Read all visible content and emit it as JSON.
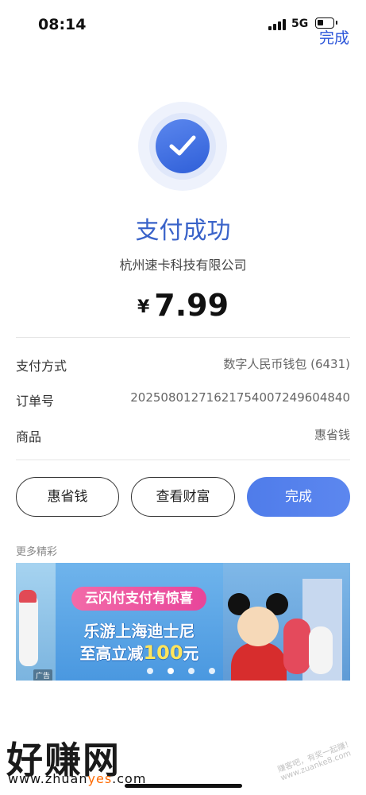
{
  "status_bar": {
    "time": "08:14",
    "network": "5G"
  },
  "header": {
    "done_link": "完成"
  },
  "result": {
    "title": "支付成功",
    "merchant": "杭州速卡科技有限公司",
    "currency_symbol": "¥",
    "amount": "7.99",
    "status_color": "#3a63c9"
  },
  "details": [
    {
      "label": "支付方式",
      "value": "数字人民币钱包 (6431)"
    },
    {
      "label": "订单号",
      "value": "20250801271621754007249604840"
    },
    {
      "label": "商品",
      "value": "惠省钱"
    }
  ],
  "actions": {
    "secondary_1": "惠省钱",
    "secondary_2": "查看财富",
    "primary": "完成",
    "primary_color": "#4f7cea"
  },
  "promo": {
    "section_label": "更多精彩",
    "pill_text": "云闪付支付有惊喜",
    "line1": "乐游上海迪士尼",
    "line2_prefix": "至高立减",
    "line2_number": "100",
    "line2_suffix": "元",
    "ad_tag": "广告",
    "carousel_total": 4,
    "carousel_active": 2
  },
  "watermark": {
    "brand": "好赚网",
    "url_prefix": "www.zhuan",
    "url_accent": "yes",
    "url_suffix": ".com",
    "stamp": "赚客吧，有奖一起赚！www.zuanke8.com"
  }
}
